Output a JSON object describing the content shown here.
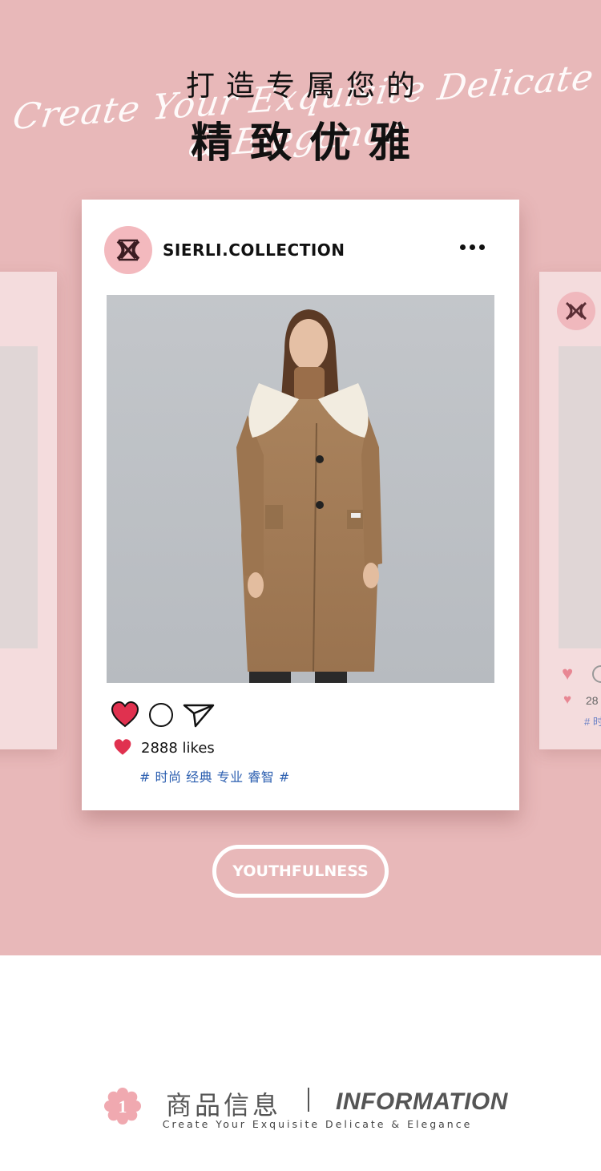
{
  "hero": {
    "title_line1": "打造专属您的",
    "title_line2": "精致优雅",
    "script_text": "Create Your Exquisite Delicate & Elegance",
    "background_color": "#e8b8b9"
  },
  "post": {
    "handle": "SIERLI.COLLECTION",
    "more_icon": "ellipsis-icon",
    "likes": "2888 likes",
    "tags": "# 时尚 经典 专业 睿智 #",
    "like_color": "#e0314f",
    "tag_color": "#2c5fb0"
  },
  "side_cards": {
    "right_likes": "28",
    "right_tag": "# 时"
  },
  "button": {
    "label": "YOUTHFULNESS"
  },
  "section": {
    "number": "1",
    "cn_title": "商品信息",
    "en_title": "INFORMATION",
    "subtitle": "Create Your Exquisite Delicate & Elegance"
  }
}
